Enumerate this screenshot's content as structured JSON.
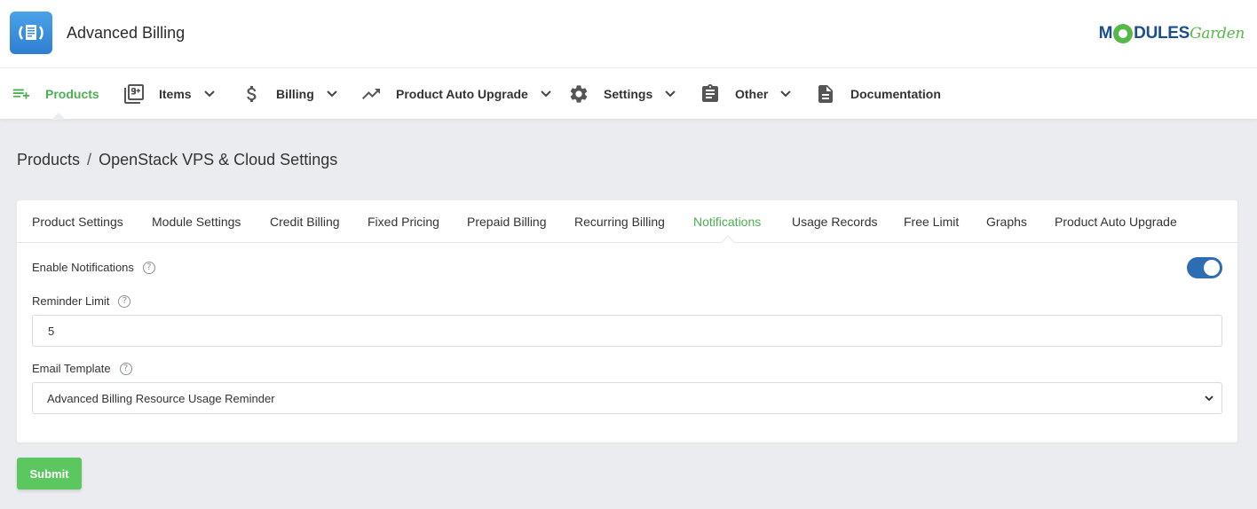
{
  "header": {
    "title": "Advanced Billing",
    "brand": {
      "part1": "M",
      "part2": "DULES",
      "part3": "Garden"
    },
    "logo_icon": "document-cycle-icon"
  },
  "nav": {
    "items": [
      {
        "label": "Products",
        "icon": "playlist-add-icon",
        "active": true,
        "dropdown": false
      },
      {
        "label": "Items",
        "icon": "filter-9-plus-icon",
        "dropdown": true
      },
      {
        "label": "Billing",
        "icon": "dollar-icon",
        "dropdown": true
      },
      {
        "label": "Product Auto Upgrade",
        "icon": "trending-up-icon",
        "dropdown": true
      },
      {
        "label": "Settings",
        "icon": "gear-icon",
        "dropdown": true
      },
      {
        "label": "Other",
        "icon": "clipboard-icon",
        "dropdown": true
      },
      {
        "label": "Documentation",
        "icon": "file-icon",
        "dropdown": false
      }
    ]
  },
  "breadcrumb": {
    "root": "Products",
    "separator": "/",
    "current": "OpenStack VPS & Cloud Settings"
  },
  "tabs": [
    {
      "label": "Product Settings"
    },
    {
      "label": "Module Settings"
    },
    {
      "label": "Credit Billing"
    },
    {
      "label": "Fixed Pricing"
    },
    {
      "label": "Prepaid Billing"
    },
    {
      "label": "Recurring Billing"
    },
    {
      "label": "Notifications",
      "active": true
    },
    {
      "label": "Usage Records"
    },
    {
      "label": "Free Limit"
    },
    {
      "label": "Graphs"
    },
    {
      "label": "Product Auto Upgrade"
    }
  ],
  "form": {
    "enable_notifications": {
      "label": "Enable Notifications",
      "help": "?",
      "value": true
    },
    "reminder_limit": {
      "label": "Reminder Limit",
      "help": "?",
      "value": "5"
    },
    "email_template": {
      "label": "Email Template",
      "help": "?",
      "selected": "Advanced Billing Resource Usage Reminder"
    }
  },
  "actions": {
    "submit_label": "Submit"
  },
  "colors": {
    "accent": "#4caf50",
    "toggle_on": "#2e6db4",
    "submit": "#5cc75f",
    "brand_blue": "#1a4e8c"
  }
}
